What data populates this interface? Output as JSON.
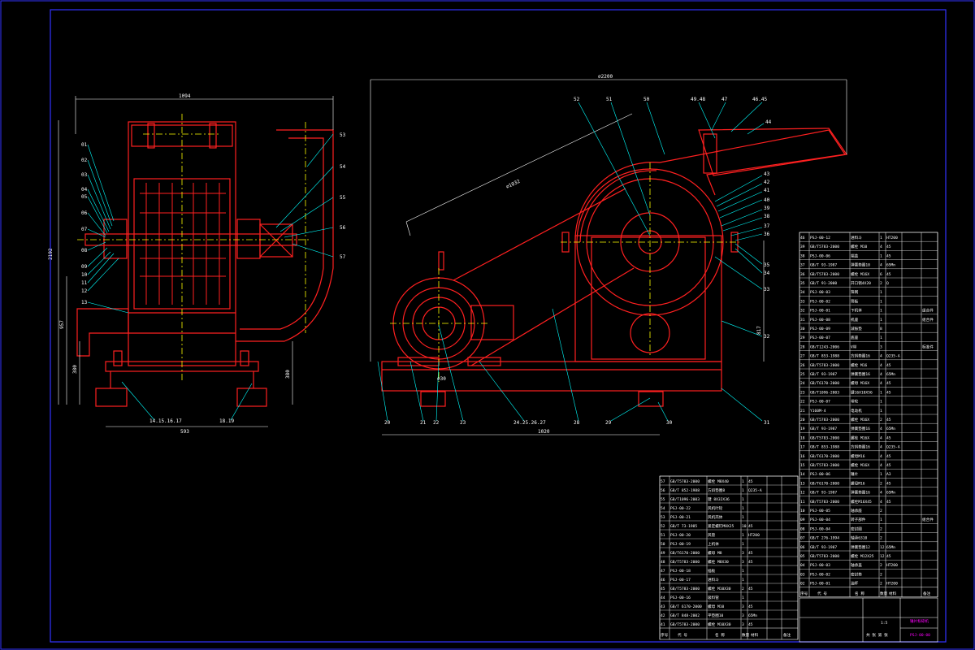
{
  "colors": {
    "background": "#000000",
    "frame": "#3333ff",
    "machine": "#ff2020",
    "leader": "#00ffff",
    "centerline": "#ffff00",
    "text": "#ffffff",
    "title": "#ff00ff"
  },
  "dimensions": {
    "left_width": "1094",
    "left_height": "2192",
    "left_lower": "957",
    "left_bottom": "593",
    "left_side": "380",
    "left_base": "380",
    "right_width": "∅2200",
    "right_length": "1020",
    "right_diag": "∅1032",
    "right_height": "817",
    "right_base": "∅30"
  },
  "left_labels": [
    "01",
    "02",
    "03",
    "04",
    "05",
    "06",
    "07",
    "08",
    "09",
    "10",
    "11",
    "12",
    "13",
    "14.15.16.17",
    "18.19",
    "53",
    "54",
    "55",
    "56",
    "57"
  ],
  "right_labels": [
    "52",
    "51",
    "50",
    "49.48",
    "47",
    "46.45",
    "44",
    "43",
    "42",
    "41",
    "40",
    "39",
    "38",
    "37",
    "36",
    "35",
    "34",
    "33",
    "32",
    "31",
    "30",
    "29",
    "28",
    "24.25.26.27",
    "23",
    "22",
    "21",
    "20"
  ],
  "parts_right": [
    {
      "no": "46",
      "code": "PSJ-00-12",
      "name": "进料斗",
      "qty": "1",
      "mat": "HT200",
      "note": ""
    },
    {
      "no": "39",
      "code": "GB/T5783-2000",
      "name": "螺栓 M10",
      "qty": "4",
      "mat": "45",
      "note": ""
    },
    {
      "no": "38",
      "code": "PSJ-00-06",
      "name": "端盖",
      "qty": "1",
      "mat": "45",
      "note": ""
    },
    {
      "no": "37",
      "code": "GB/T 93-1987",
      "name": "弹簧垫圈10",
      "qty": "4",
      "mat": "65Mn",
      "note": ""
    },
    {
      "no": "36",
      "code": "GB/T5783-2000",
      "name": "螺栓 M16X",
      "qty": "6",
      "mat": "45",
      "note": ""
    },
    {
      "no": "35",
      "code": "GB/T 91-2000",
      "name": "开口销4X20",
      "qty": "2",
      "mat": "Q",
      "note": ""
    },
    {
      "no": "34",
      "code": "PSJ-00-03",
      "name": "筛网",
      "qty": "1",
      "mat": "",
      "note": ""
    },
    {
      "no": "33",
      "code": "PSJ-00-02",
      "name": "筛板",
      "qty": "1",
      "mat": "",
      "note": ""
    },
    {
      "no": "32",
      "code": "PSJ-00-01",
      "name": "下机体",
      "qty": "1",
      "mat": "",
      "note": "组合件"
    },
    {
      "no": "31",
      "code": "PSJ-00-08",
      "name": "机座",
      "qty": "1",
      "mat": "",
      "note": "组合件"
    },
    {
      "no": "30",
      "code": "PSJ-00-09",
      "name": "减振垫",
      "qty": "8",
      "mat": "",
      "note": ""
    },
    {
      "no": "29",
      "code": "PSJ-00-07",
      "name": "底座",
      "qty": "1",
      "mat": "",
      "note": ""
    },
    {
      "no": "28",
      "code": "GB/T1243-2006",
      "name": "V带",
      "qty": "3",
      "mat": "",
      "note": "标准件"
    },
    {
      "no": "27",
      "code": "GB/T 853-1988",
      "name": "方斜垫圈16",
      "qty": "4",
      "mat": "Q235-A",
      "note": ""
    },
    {
      "no": "26",
      "code": "GB/T5783-2000",
      "name": "螺栓 M16",
      "qty": "4",
      "mat": "45",
      "note": ""
    },
    {
      "no": "25",
      "code": "GB/T 93-1987",
      "name": "弹簧垫圈16",
      "qty": "4",
      "mat": "65Mn",
      "note": ""
    },
    {
      "no": "24",
      "code": "GB/T6170-2000",
      "name": "螺母 M16X",
      "qty": "4",
      "mat": "45",
      "note": ""
    },
    {
      "no": "23",
      "code": "GB/T1096-2003",
      "name": "键16X10X56",
      "qty": "1",
      "mat": "45",
      "note": ""
    },
    {
      "no": "22",
      "code": "PSJ-00-07",
      "name": "带轮",
      "qty": "1",
      "mat": "",
      "note": ""
    },
    {
      "no": "21",
      "code": "Y160M-4",
      "name": "电动机",
      "qty": "1",
      "mat": "",
      "note": ""
    },
    {
      "no": "20",
      "code": "GB/T5783-2000",
      "name": "螺栓 M16X",
      "qty": "2",
      "mat": "45",
      "note": ""
    },
    {
      "no": "19",
      "code": "GB/T 93-1987",
      "name": "弹簧垫圈16",
      "qty": "4",
      "mat": "65Mn",
      "note": ""
    },
    {
      "no": "18",
      "code": "GB/T5783-2000",
      "name": "螺栓 M16X",
      "qty": "4",
      "mat": "45",
      "note": ""
    },
    {
      "no": "17",
      "code": "GB/T 853-1988",
      "name": "方斜垫圈16",
      "qty": "4",
      "mat": "Q235-A",
      "note": ""
    },
    {
      "no": "16",
      "code": "GB/T6170-2000",
      "name": "螺母M16",
      "qty": "4",
      "mat": "45",
      "note": ""
    },
    {
      "no": "15",
      "code": "GB/T5783-2000",
      "name": "螺栓 M16X",
      "qty": "4",
      "mat": "45",
      "note": ""
    },
    {
      "no": "14",
      "code": "PSJ-00-06",
      "name": "锤片",
      "qty": "1",
      "mat": "A3",
      "note": ""
    },
    {
      "no": "13",
      "code": "GB/T6170-2000",
      "name": "螺母M16",
      "qty": "2",
      "mat": "45",
      "note": ""
    },
    {
      "no": "12",
      "code": "GB/T 93-1987",
      "name": "弹簧垫圈16",
      "qty": "4",
      "mat": "65Mn",
      "note": ""
    },
    {
      "no": "11",
      "code": "GB/T5783-2000",
      "name": "螺栓M16X45",
      "qty": "4",
      "mat": "45",
      "note": ""
    },
    {
      "no": "10",
      "code": "PSJ-00-05",
      "name": "轴承座",
      "qty": "2",
      "mat": "",
      "note": ""
    },
    {
      "no": "09",
      "code": "PSJ-00-04",
      "name": "转子部件",
      "qty": "1",
      "mat": "",
      "note": "组合件"
    },
    {
      "no": "08",
      "code": "PSJ-00-04",
      "name": "密封圈",
      "qty": "2",
      "mat": "",
      "note": ""
    },
    {
      "no": "07",
      "code": "GB/T 276-1994",
      "name": "轴承6310",
      "qty": "2",
      "mat": "",
      "note": ""
    },
    {
      "no": "06",
      "code": "GB/T 93-1987",
      "name": "弹簧垫圈12",
      "qty": "12",
      "mat": "65Mn",
      "note": ""
    },
    {
      "no": "05",
      "code": "GB/T5783-2000",
      "name": "螺栓 M12X25",
      "qty": "12",
      "mat": "45",
      "note": ""
    },
    {
      "no": "04",
      "code": "PSJ-00-03",
      "name": "轴承盖",
      "qty": "2",
      "mat": "HT200",
      "note": ""
    },
    {
      "no": "03",
      "code": "PSJ-00-02",
      "name": "密封垫",
      "qty": "2",
      "mat": "",
      "note": ""
    },
    {
      "no": "02",
      "code": "PSJ-00-01",
      "name": "油杯",
      "qty": "2",
      "mat": "HT200",
      "note": ""
    }
  ],
  "parts_left": [
    {
      "no": "57",
      "code": "GB/T5783-2000",
      "name": "螺栓 M8X40",
      "qty": "1",
      "mat": "45"
    },
    {
      "no": "56",
      "code": "GB/T 852-1988",
      "name": "方斜垫圈8",
      "qty": "1",
      "mat": "Q235-A"
    },
    {
      "no": "55",
      "code": "GB/T1096-2003",
      "name": "键 8X32X36",
      "qty": "1",
      "mat": ""
    },
    {
      "no": "54",
      "code": "PSJ-00-22",
      "name": "风机叶轮",
      "qty": "1",
      "mat": ""
    },
    {
      "no": "53",
      "code": "PSJ-00-21",
      "name": "风机壳体",
      "qty": "1",
      "mat": ""
    },
    {
      "no": "52",
      "code": "GB/T 73-1985",
      "name": "紧定螺钉M8X25",
      "qty": "10",
      "mat": "45"
    },
    {
      "no": "51",
      "code": "PSJ-00-20",
      "name": "风管",
      "qty": "1",
      "mat": "HT200"
    },
    {
      "no": "50",
      "code": "PSJ-00-19",
      "name": "上机体",
      "qty": "1",
      "mat": ""
    },
    {
      "no": "49",
      "code": "GB/T6170-2000",
      "name": "螺母 M8",
      "qty": "3",
      "mat": "45"
    },
    {
      "no": "48",
      "code": "GB/T5783-2000",
      "name": "螺栓 M8X30",
      "qty": "3",
      "mat": "45"
    },
    {
      "no": "47",
      "code": "PSJ-00-18",
      "name": "插板",
      "qty": "1",
      "mat": ""
    },
    {
      "no": "46",
      "code": "PSJ-00-17",
      "name": "进料斗",
      "qty": "1",
      "mat": ""
    },
    {
      "no": "45",
      "code": "GB/T5783-2000",
      "name": "螺栓 M10X30",
      "qty": "2",
      "mat": "45"
    },
    {
      "no": "44",
      "code": "PSJ-00-16",
      "name": "吸料管",
      "qty": "1",
      "mat": ""
    },
    {
      "no": "43",
      "code": "GB/T 6170-2000",
      "name": "螺母 M10",
      "qty": "3",
      "mat": "45"
    },
    {
      "no": "42",
      "code": "GB/T 848-2002",
      "name": "平垫圈10",
      "qty": "3",
      "mat": "65Mn"
    },
    {
      "no": "41",
      "code": "GB/T5783-2000",
      "name": "螺栓 M10X30",
      "qty": "3",
      "mat": "45"
    }
  ],
  "table_headers": {
    "no": "序号",
    "code": "代 号",
    "name": "名 称",
    "qty": "数量",
    "mat": "材料",
    "note": "备注"
  },
  "title_block": {
    "name": "锤片粉碎机",
    "drawing_no": "PSJ-00-00",
    "scale": "1:5",
    "weight": "",
    "sheet": "共 张 第 张"
  }
}
